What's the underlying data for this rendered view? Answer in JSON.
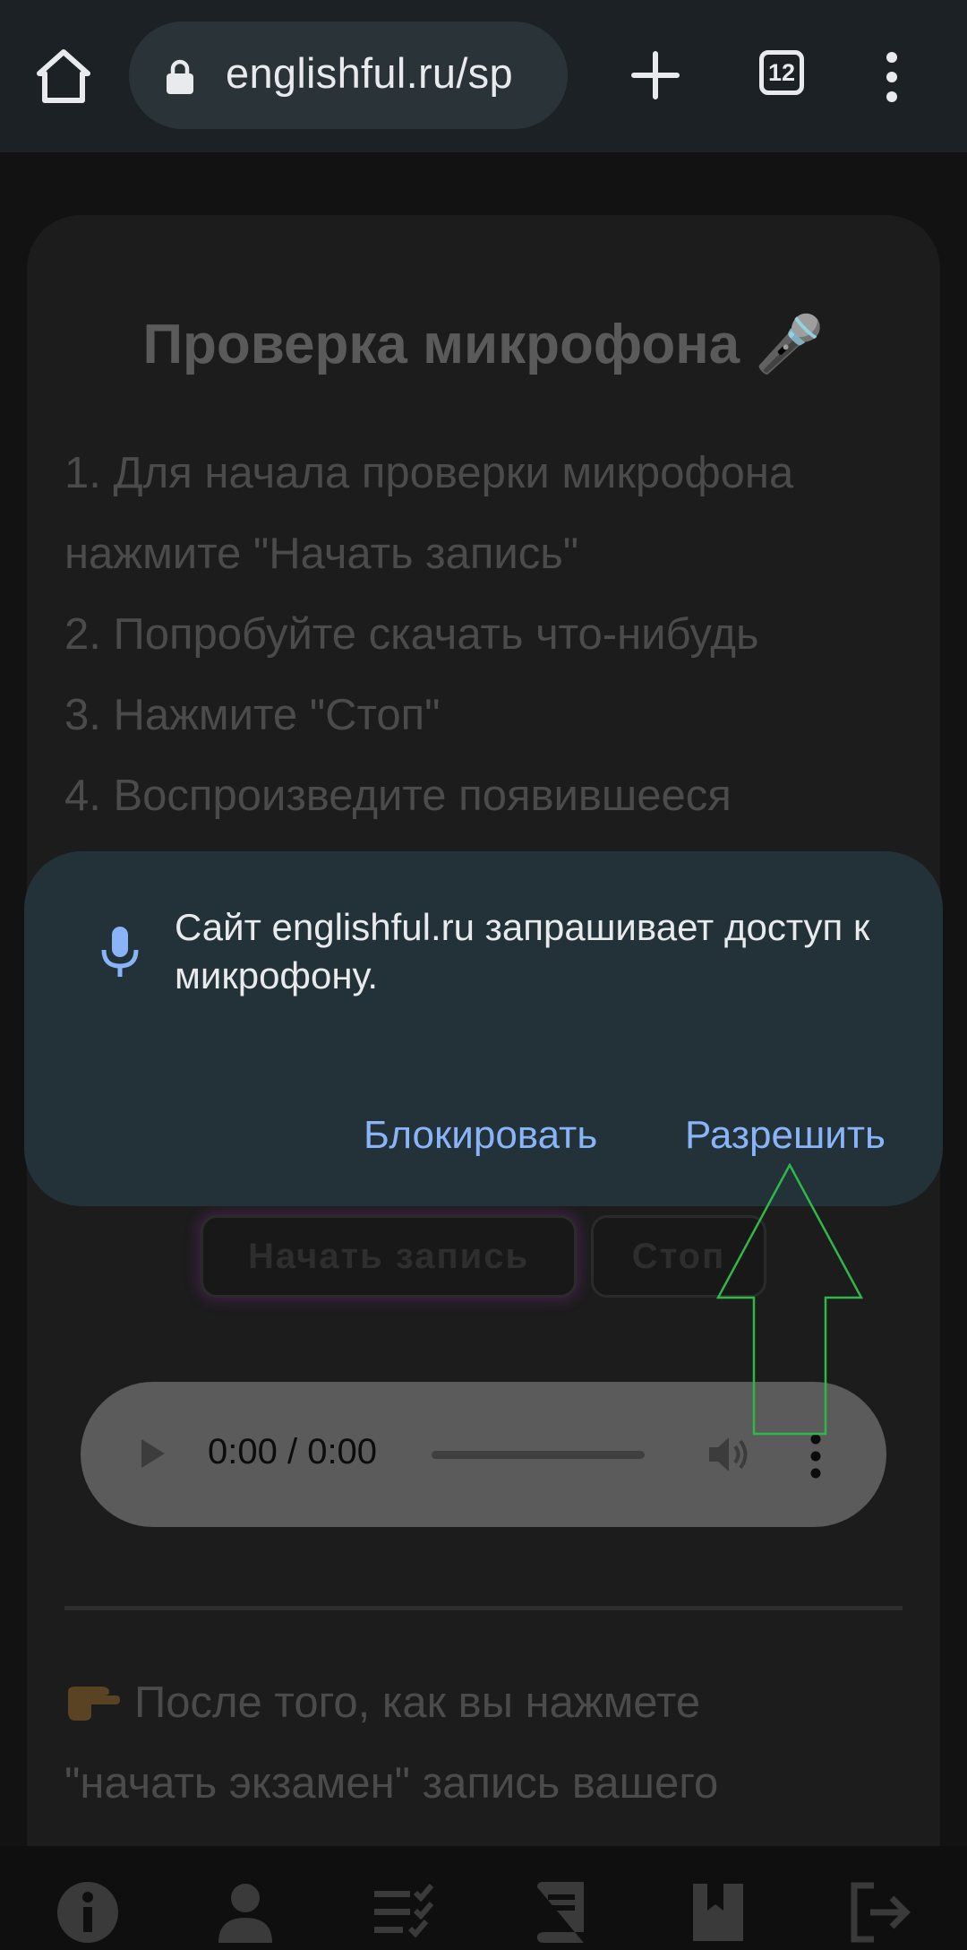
{
  "browser": {
    "url": "englishful.ru/sp",
    "tab_count": "12"
  },
  "page": {
    "title": "Проверка микрофона 🎤",
    "instructions": [
      "1. Для начала проверки микрофона",
      "нажмите \"Начать запись\"",
      "2. Попробуйте скачать что-нибудь",
      "3. Нажмите \"Стоп\"",
      "4. Воспроизведите появившееся"
    ],
    "record_button": "Начать запись",
    "stop_button": "Стоп",
    "player_time": "0:00 / 0:00",
    "after_text": [
      "После того, как вы нажмете",
      "\"начать экзамен\" запись вашего"
    ]
  },
  "dialog": {
    "message": "Сайт englishful.ru запрашивает доступ к микрофону.",
    "block_label": "Блокировать",
    "allow_label": "Разрешить"
  },
  "colors": {
    "dialog_bg": "#233238",
    "accent": "#8ab4f8",
    "annotation_arrow": "#2fb84a"
  },
  "bottom_nav": {
    "icons": [
      "info-icon",
      "profile-icon",
      "checklist-icon",
      "book-icon",
      "bookmark-icon",
      "logout-icon"
    ]
  }
}
